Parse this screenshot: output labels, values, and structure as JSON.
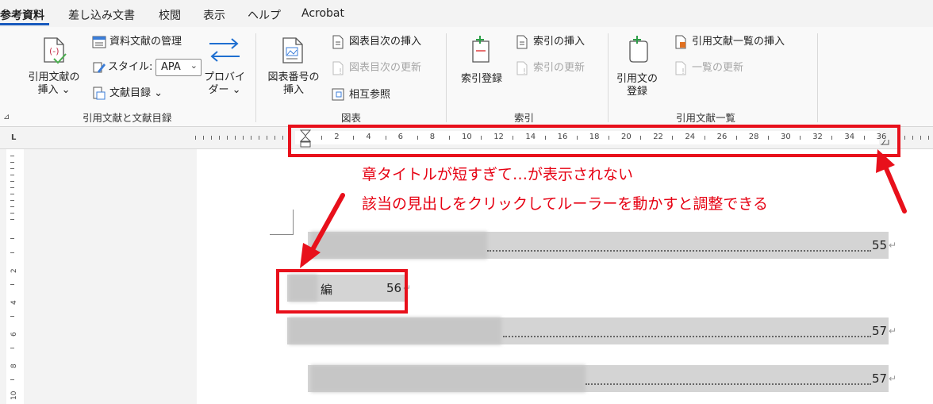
{
  "tabs": [
    {
      "label": "参考資料",
      "active": true
    },
    {
      "label": "差し込み文書",
      "active": false
    },
    {
      "label": "校閲",
      "active": false
    },
    {
      "label": "表示",
      "active": false
    },
    {
      "label": "ヘルプ",
      "active": false
    },
    {
      "label": "Acrobat",
      "active": false
    }
  ],
  "ribbon": {
    "citations": {
      "insert_citation": [
        "引用文献の",
        "挿入 ⌄"
      ],
      "manage_sources": "資料文献の管理",
      "style_label": "スタイル:",
      "style_value": "APA",
      "bibliography": "文献目録 ⌄",
      "provider": [
        "プロバイ",
        "ダー ⌄"
      ],
      "group": "引用文献と文献目録"
    },
    "captions": {
      "insert_caption": [
        "図表番号の",
        "挿入"
      ],
      "insert_table_of_figures": "図表目次の挿入",
      "update_table": "図表目次の更新",
      "cross_reference": "相互参照",
      "group": "図表"
    },
    "index": {
      "mark_entry": "索引登録",
      "insert_index": "索引の挿入",
      "update_index": "索引の更新",
      "group": "索引"
    },
    "authorities": {
      "mark_citation": [
        "引用文の",
        "登録"
      ],
      "insert_table_of_authorities": "引用文献一覧の挿入",
      "update_table": "一覧の更新",
      "group": "引用文献一覧"
    },
    "dialog_launcher": "⊿"
  },
  "ruler": {
    "corner": "L",
    "numbers": [
      "2",
      "4",
      "6",
      "8",
      "10",
      "12",
      "14",
      "16",
      "18",
      "20",
      "22",
      "24",
      "26",
      "28",
      "30",
      "32",
      "34",
      "36"
    ]
  },
  "vruler": {
    "numbers": [
      "2",
      "4",
      "6",
      "8",
      "10"
    ]
  },
  "document": {
    "entries": [
      {
        "page": "55"
      },
      {
        "text": "編",
        "page": "56"
      },
      {
        "page": "57"
      },
      {
        "page": "57"
      }
    ],
    "return_mark": "↵"
  },
  "annotations": {
    "line1": "章タイトルが短すぎて…が表示されない",
    "line2": "該当の見出しをクリックしてルーラーを動かすと調整できる"
  },
  "colors": {
    "accent": "#185abd",
    "annotation_red": "#e8101b"
  }
}
